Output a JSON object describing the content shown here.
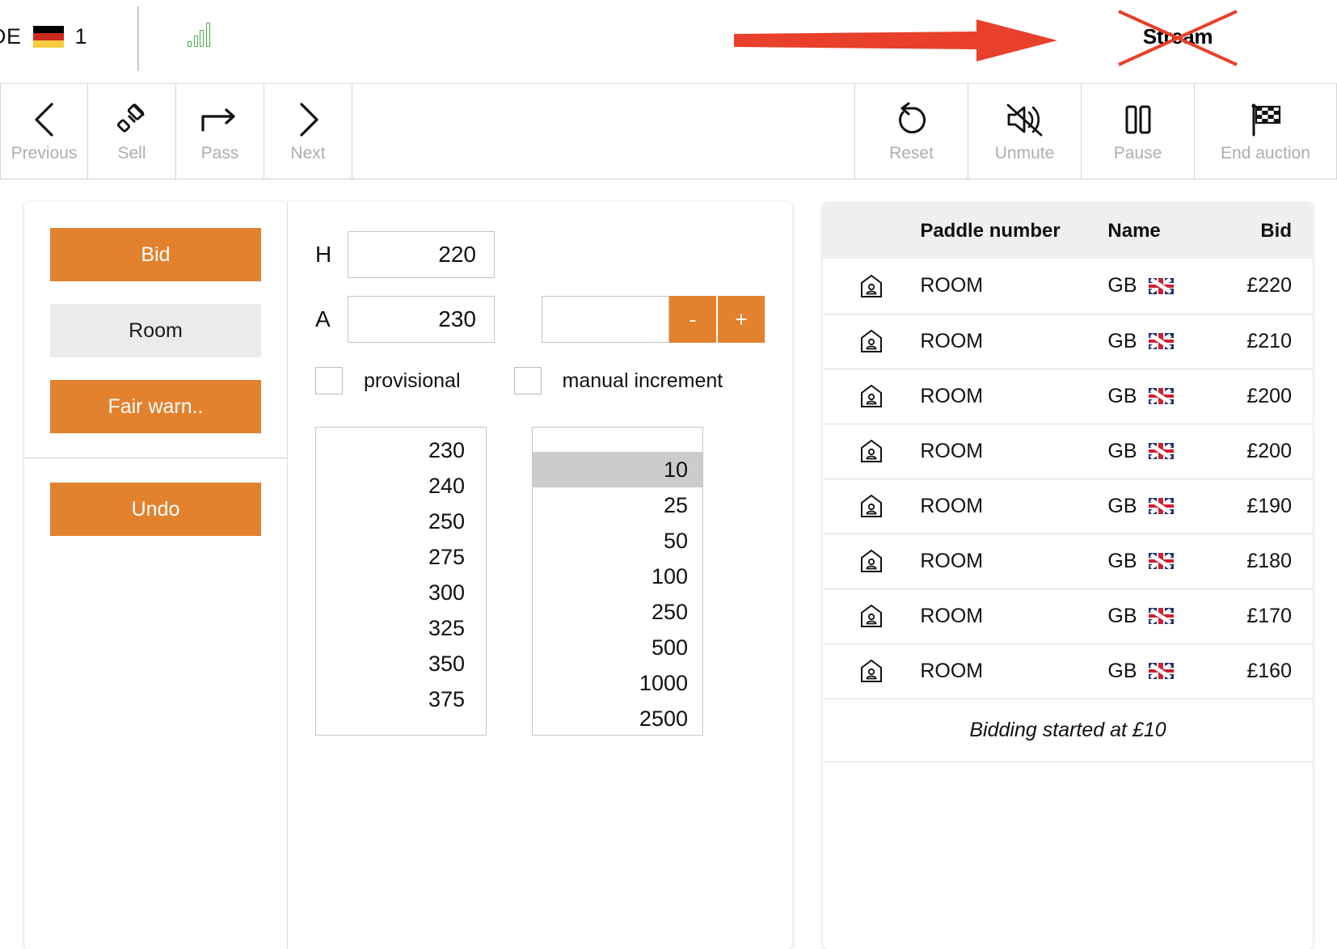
{
  "statusbar": {
    "locale_code": "DE",
    "flag_icon": "flag-de-icon",
    "count": "1",
    "signal_icon": "signal-bars-icon"
  },
  "annotations": {
    "arrow_icon": "red-arrow-icon",
    "arrow_color": "#e8402a",
    "stream_label": "Stream",
    "cross_icon": "red-cross-out-icon"
  },
  "toolbar": {
    "left_buttons": [
      {
        "label": "Previous",
        "icon": "chevron-left-icon"
      },
      {
        "label": "Sell",
        "icon": "gavel-icon"
      },
      {
        "label": "Pass",
        "icon": "arrow-right-turn-icon"
      },
      {
        "label": "Next",
        "icon": "chevron-right-icon"
      }
    ],
    "right_buttons": [
      {
        "label": "Reset",
        "icon": "undo-arrow-icon"
      },
      {
        "label": "Unmute",
        "icon": "speaker-muted-icon"
      },
      {
        "label": "Pause",
        "icon": "pause-icon"
      },
      {
        "label": "End auction",
        "icon": "checkered-flag-icon"
      }
    ]
  },
  "bid_panel": {
    "bid_label": "Bid",
    "room_label": "Room",
    "fair_warning_label": "Fair warn..",
    "undo_label": "Undo"
  },
  "center_panel": {
    "hammer_label": "H",
    "hammer_value": "220",
    "ask_label": "A",
    "ask_value": "230",
    "increment_input_value": "",
    "increment_input_placeholder": "",
    "minus_label": "-",
    "plus_label": "+",
    "provisional_label": "provisional",
    "provisional_checked": false,
    "manual_increment_label": "manual increment",
    "manual_increment_checked": false,
    "bid_steps": [
      "230",
      "240",
      "250",
      "275",
      "300",
      "325",
      "350",
      "375"
    ],
    "increments": [
      "10",
      "25",
      "50",
      "100",
      "250",
      "500",
      "1000",
      "2500"
    ],
    "selected_increment": "10"
  },
  "bid_table": {
    "columns": [
      "",
      "Paddle number",
      "Name",
      "Bid"
    ],
    "rows": [
      {
        "icon": "room-paddle-icon",
        "paddle": "ROOM",
        "name": "GB",
        "flag": "flag-gb-icon",
        "bid": "£220"
      },
      {
        "icon": "room-paddle-icon",
        "paddle": "ROOM",
        "name": "GB",
        "flag": "flag-gb-icon",
        "bid": "£210"
      },
      {
        "icon": "room-paddle-icon",
        "paddle": "ROOM",
        "name": "GB",
        "flag": "flag-gb-icon",
        "bid": "£200"
      },
      {
        "icon": "room-paddle-icon",
        "paddle": "ROOM",
        "name": "GB",
        "flag": "flag-gb-icon",
        "bid": "£200"
      },
      {
        "icon": "room-paddle-icon",
        "paddle": "ROOM",
        "name": "GB",
        "flag": "flag-gb-icon",
        "bid": "£190"
      },
      {
        "icon": "room-paddle-icon",
        "paddle": "ROOM",
        "name": "GB",
        "flag": "flag-gb-icon",
        "bid": "£180"
      },
      {
        "icon": "room-paddle-icon",
        "paddle": "ROOM",
        "name": "GB",
        "flag": "flag-gb-icon",
        "bid": "£170"
      },
      {
        "icon": "room-paddle-icon",
        "paddle": "ROOM",
        "name": "GB",
        "flag": "flag-gb-icon",
        "bid": "£160"
      }
    ],
    "footer_note": "Bidding started at £10"
  },
  "colors": {
    "accent_orange": "#e2822f",
    "annotation_red": "#e8402a",
    "header_grey": "#efefef",
    "selected_grey": "#cccccc",
    "disabled_text": "#adadad"
  }
}
